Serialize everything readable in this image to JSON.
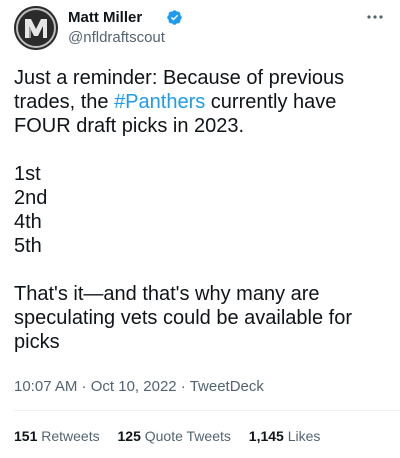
{
  "author": {
    "name": "Matt Miller",
    "handle": "@nfldraftscout",
    "avatar_icon": "mm-logo-avatar",
    "verified_icon": "verified-badge-icon",
    "verified_color": "#1d9bf0"
  },
  "tweet": {
    "intro_before_hashtag": "Just a reminder: Because of previous trades, the ",
    "hashtag": "#Panthers",
    "intro_after_hashtag": " currently have FOUR draft picks in 2023.",
    "picks": [
      "1st",
      "2nd",
      "4th",
      "5th"
    ],
    "closing": "That's it—and that's why many are speculating vets could be available for picks"
  },
  "meta": {
    "time": "10:07 AM",
    "separator": " · ",
    "date": "Oct 10, 2022",
    "source": "TweetDeck"
  },
  "stats": {
    "retweets_count": "151",
    "retweets_label": "Retweets",
    "quotes_count": "125",
    "quotes_label": "Quote Tweets",
    "likes_count": "1,145",
    "likes_label": "Likes"
  },
  "colors": {
    "link": "#1d9bf0",
    "text": "#0f1419",
    "secondary": "#536471"
  },
  "icons": {
    "more": "more-options-icon"
  }
}
